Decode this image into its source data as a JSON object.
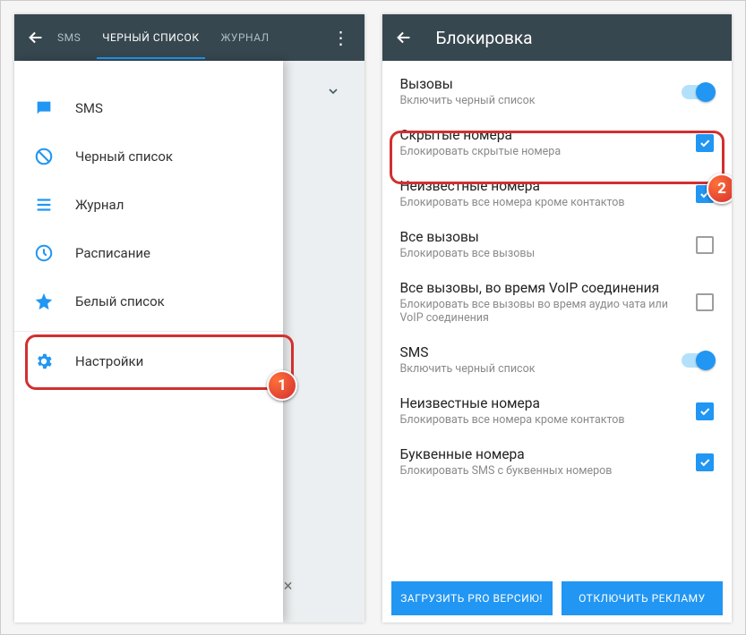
{
  "left": {
    "tabs": {
      "sms": "SMS",
      "blacklist": "ЧЕРНЫЙ СПИСОК",
      "log": "ЖУРНАЛ"
    },
    "menu": {
      "sms": "SMS",
      "blacklist": "Черный список",
      "log": "Журнал",
      "schedule": "Расписание",
      "whitelist": "Белый список",
      "settings": "Настройки"
    },
    "badge1": "1",
    "colors": {
      "accent": "#2196F3",
      "appbar": "#37474F",
      "highlight": "#d32f2f"
    }
  },
  "right": {
    "title": "Блокировка",
    "rows": {
      "calls": {
        "title": "Вызовы",
        "sub": "Включить черный список",
        "control": "switch"
      },
      "hidden": {
        "title": "Скрытые номера",
        "sub": "Блокировать скрытые номера",
        "control": "check_on"
      },
      "unknown": {
        "title": "Неизвестные номера",
        "sub": "Блокировать все номера кроме контактов",
        "control": "check_on"
      },
      "allcalls": {
        "title": "Все вызовы",
        "sub": "Блокировать все вызовы",
        "control": "check_off"
      },
      "voip": {
        "title": "Все вызовы, во время VoIP соединения",
        "sub": "Блокировать все вызовы во время аудио чата или VoIP соединения",
        "control": "check_off"
      },
      "sms": {
        "title": "SMS",
        "sub": "Включить черный список",
        "control": "switch"
      },
      "unknown2": {
        "title": "Неизвестные номера",
        "sub": "Блокировать все номера кроме контактов",
        "control": "check_on"
      },
      "letters": {
        "title": "Буквенные номера",
        "sub": "Блокировать SMS с буквенных номеров",
        "control": "check_on"
      }
    },
    "buttons": {
      "pro": "ЗАГРУЗИТЬ PRO ВЕРСИЮ!",
      "ads": "ОТКЛЮЧИТЬ РЕКЛАМУ"
    },
    "badge2": "2"
  }
}
